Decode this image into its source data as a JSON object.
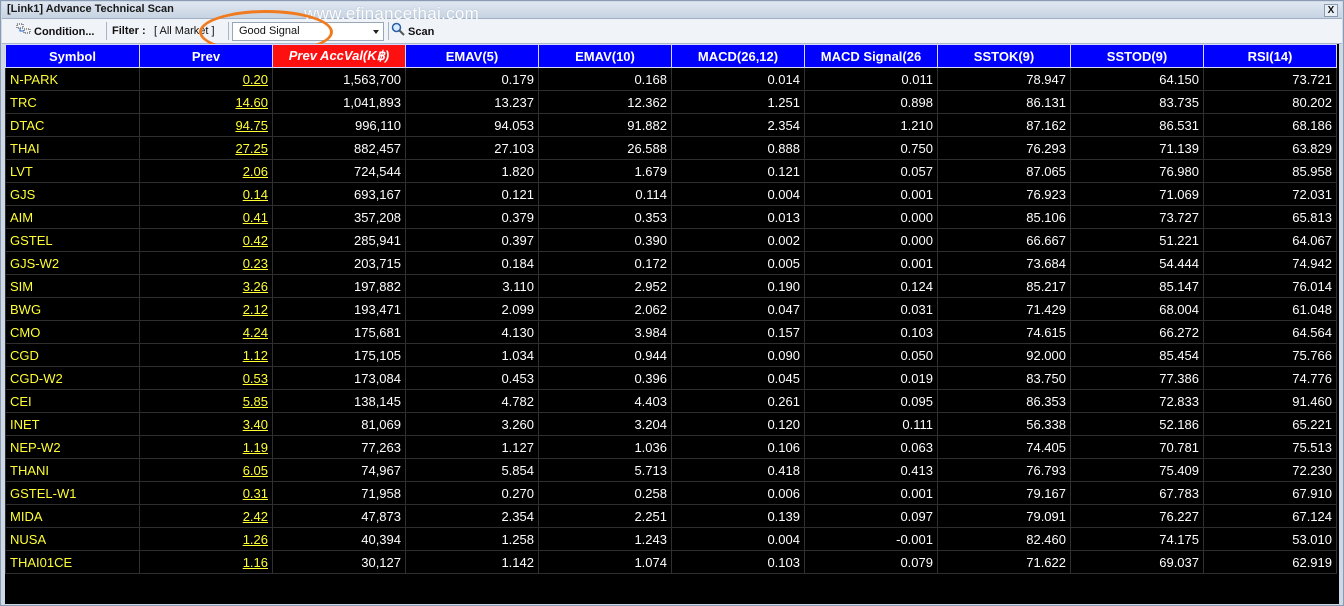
{
  "window": {
    "title": "[Link1] Advance Technical Scan",
    "watermark": "www.efinancethai.com",
    "close_label": "X"
  },
  "toolbar": {
    "condition_label": "Condition...",
    "filter_label": "Filter :",
    "filter_value": "[ All Market ]",
    "signal_select": {
      "value": "Good Signal"
    },
    "scan_label": "Scan"
  },
  "highlight_color": "#f07a1e",
  "table": {
    "headers": [
      "Symbol",
      "Prev",
      "Prev AccVal(K฿)",
      "EMAV(5)",
      "EMAV(10)",
      "MACD(26,12)",
      "MACD Signal(26",
      "SSTOK(9)",
      "SSTOD(9)",
      "RSI(14)"
    ],
    "sorted_column_index": 2,
    "rows": [
      [
        "N-PARK",
        "0.20",
        "1,563,700",
        "0.179",
        "0.168",
        "0.014",
        "0.011",
        "78.947",
        "64.150",
        "73.721"
      ],
      [
        "TRC",
        "14.60",
        "1,041,893",
        "13.237",
        "12.362",
        "1.251",
        "0.898",
        "86.131",
        "83.735",
        "80.202"
      ],
      [
        "DTAC",
        "94.75",
        "996,110",
        "94.053",
        "91.882",
        "2.354",
        "1.210",
        "87.162",
        "86.531",
        "68.186"
      ],
      [
        "THAI",
        "27.25",
        "882,457",
        "27.103",
        "26.588",
        "0.888",
        "0.750",
        "76.293",
        "71.139",
        "63.829"
      ],
      [
        "LVT",
        "2.06",
        "724,544",
        "1.820",
        "1.679",
        "0.121",
        "0.057",
        "87.065",
        "76.980",
        "85.958"
      ],
      [
        "GJS",
        "0.14",
        "693,167",
        "0.121",
        "0.114",
        "0.004",
        "0.001",
        "76.923",
        "71.069",
        "72.031"
      ],
      [
        "AIM",
        "0.41",
        "357,208",
        "0.379",
        "0.353",
        "0.013",
        "0.000",
        "85.106",
        "73.727",
        "65.813"
      ],
      [
        "GSTEL",
        "0.42",
        "285,941",
        "0.397",
        "0.390",
        "0.002",
        "0.000",
        "66.667",
        "51.221",
        "64.067"
      ],
      [
        "GJS-W2",
        "0.23",
        "203,715",
        "0.184",
        "0.172",
        "0.005",
        "0.001",
        "73.684",
        "54.444",
        "74.942"
      ],
      [
        "SIM",
        "3.26",
        "197,882",
        "3.110",
        "2.952",
        "0.190",
        "0.124",
        "85.217",
        "85.147",
        "76.014"
      ],
      [
        "BWG",
        "2.12",
        "193,471",
        "2.099",
        "2.062",
        "0.047",
        "0.031",
        "71.429",
        "68.004",
        "61.048"
      ],
      [
        "CMO",
        "4.24",
        "175,681",
        "4.130",
        "3.984",
        "0.157",
        "0.103",
        "74.615",
        "66.272",
        "64.564"
      ],
      [
        "CGD",
        "1.12",
        "175,105",
        "1.034",
        "0.944",
        "0.090",
        "0.050",
        "92.000",
        "85.454",
        "75.766"
      ],
      [
        "CGD-W2",
        "0.53",
        "173,084",
        "0.453",
        "0.396",
        "0.045",
        "0.019",
        "83.750",
        "77.386",
        "74.776"
      ],
      [
        "CEI",
        "5.85",
        "138,145",
        "4.782",
        "4.403",
        "0.261",
        "0.095",
        "86.353",
        "72.833",
        "91.460"
      ],
      [
        "INET",
        "3.40",
        "81,069",
        "3.260",
        "3.204",
        "0.120",
        "0.111",
        "56.338",
        "52.186",
        "65.221"
      ],
      [
        "NEP-W2",
        "1.19",
        "77,263",
        "1.127",
        "1.036",
        "0.106",
        "0.063",
        "74.405",
        "70.781",
        "75.513"
      ],
      [
        "THANI",
        "6.05",
        "74,967",
        "5.854",
        "5.713",
        "0.418",
        "0.413",
        "76.793",
        "75.409",
        "72.230"
      ],
      [
        "GSTEL-W1",
        "0.31",
        "71,958",
        "0.270",
        "0.258",
        "0.006",
        "0.001",
        "79.167",
        "67.783",
        "67.910"
      ],
      [
        "MIDA",
        "2.42",
        "47,873",
        "2.354",
        "2.251",
        "0.139",
        "0.097",
        "79.091",
        "76.227",
        "67.124"
      ],
      [
        "NUSA",
        "1.26",
        "40,394",
        "1.258",
        "1.243",
        "0.004",
        "-0.001",
        "82.460",
        "74.175",
        "53.010"
      ],
      [
        "THAI01CE",
        "1.16",
        "30,127",
        "1.142",
        "1.074",
        "0.103",
        "0.079",
        "71.622",
        "69.037",
        "62.919"
      ]
    ]
  }
}
